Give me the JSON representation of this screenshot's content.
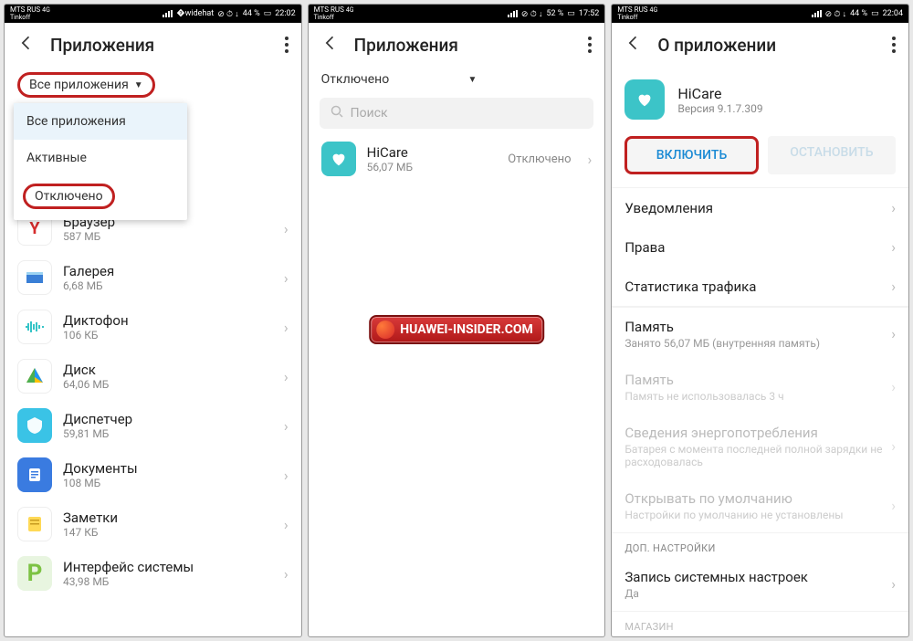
{
  "status": {
    "carrier": "MTS RUS",
    "sub": "Tinkoff",
    "battery1": "44 %",
    "time1": "22:02",
    "battery2": "52 %",
    "time2": "17:52",
    "battery3": "44 %",
    "time3": "22:04"
  },
  "screen1": {
    "title": "Приложения",
    "filter": "Все приложения",
    "dropdown": {
      "all": "Все приложения",
      "active": "Активные",
      "disabled": "Отключено"
    },
    "apps": [
      {
        "name": "Браузер",
        "size": "587 МБ"
      },
      {
        "name": "Галерея",
        "size": "6,68 МБ"
      },
      {
        "name": "Диктофон",
        "size": "106 КБ"
      },
      {
        "name": "Диск",
        "size": "64,06 МБ"
      },
      {
        "name": "Диспетчер",
        "size": "59,81 МБ"
      },
      {
        "name": "Документы",
        "size": "108 МБ"
      },
      {
        "name": "Заметки",
        "size": "147 КБ"
      },
      {
        "name": "Интерфейс системы",
        "size": "43,98 МБ"
      }
    ]
  },
  "screen2": {
    "title": "Приложения",
    "filter": "Отключено",
    "search": "Поиск",
    "app": {
      "name": "HiCare",
      "size": "56,07 МБ",
      "status": "Отключено"
    }
  },
  "screen3": {
    "title": "О приложении",
    "app": {
      "name": "HiCare",
      "version": "Версия 9.1.7.309"
    },
    "btn_enable": "ВКЛЮЧИТЬ",
    "btn_stop": "ОСТАНОВИТЬ",
    "rows": {
      "notifications": "Уведомления",
      "permissions": "Права",
      "traffic": "Статистика трафика",
      "memory": "Память",
      "memory_sub": "Занято 56,07 МБ (внутренняя память)",
      "memory2": "Память",
      "memory2_sub": "Память не использовалась 3 ч",
      "power": "Сведения энергопотребления",
      "power_sub": "Батарея с момента последней полной зарядки не расходовалась",
      "default": "Открывать по умолчанию",
      "default_sub": "Настройки по умолчанию не установлены",
      "section_extra": "ДОП. НАСТРОЙКИ",
      "syswrite": "Запись системных настроек",
      "syswrite_val": "Да",
      "store": "МАГАЗИН"
    }
  },
  "watermark": "HUAWEI-INSIDER.COM"
}
